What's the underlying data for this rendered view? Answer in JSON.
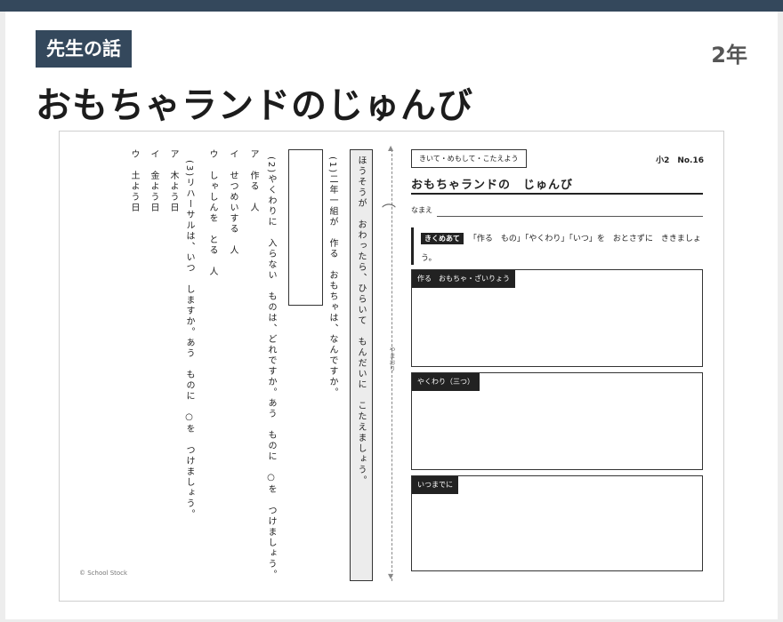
{
  "header": {
    "badge": "先生の話",
    "grade": "2年",
    "title": "おもちゃランドのじゅんび"
  },
  "worksheet": {
    "copyright": "© School Stock",
    "left_page": {
      "q3_options": [
        "ウ　土よう日",
        "イ　金よう日",
        "ア　木よう日"
      ],
      "q3_prompt": "(3)リハーサルは、いつ　しますか。あう　ものに　○を　つけましょう。",
      "q2_options": [
        "ウ　しゃしんを　とる　人",
        "イ　せつめいする　人",
        "ア　作る　人"
      ],
      "q2_prompt": "(2)やくわりに　入らない　ものは、どれですか。あう　ものに　○を　つけましょう。",
      "q1_prompt": "(1)二年一組が　作る　おもちゃは、なんですか。",
      "instruction": "ほうそうが　おわったら、ひらいて　もんだいに　こたえましょう。",
      "fold_label": "やまおり"
    },
    "right_page": {
      "tag": "きいて・めもして・こたえよう",
      "sheet_no": "小2　No.16",
      "title": "おもちゃランドの　じゅんび",
      "name_label": "なまえ",
      "point_tag": "きくめあて",
      "point_text": "「作る　もの」「やくわり」「いつ」を　おとさずに　ききましょう。",
      "box_labels": [
        "作る　おもちゃ・ざいりょう",
        "やくわり（三つ）",
        "いつまでに"
      ]
    }
  }
}
